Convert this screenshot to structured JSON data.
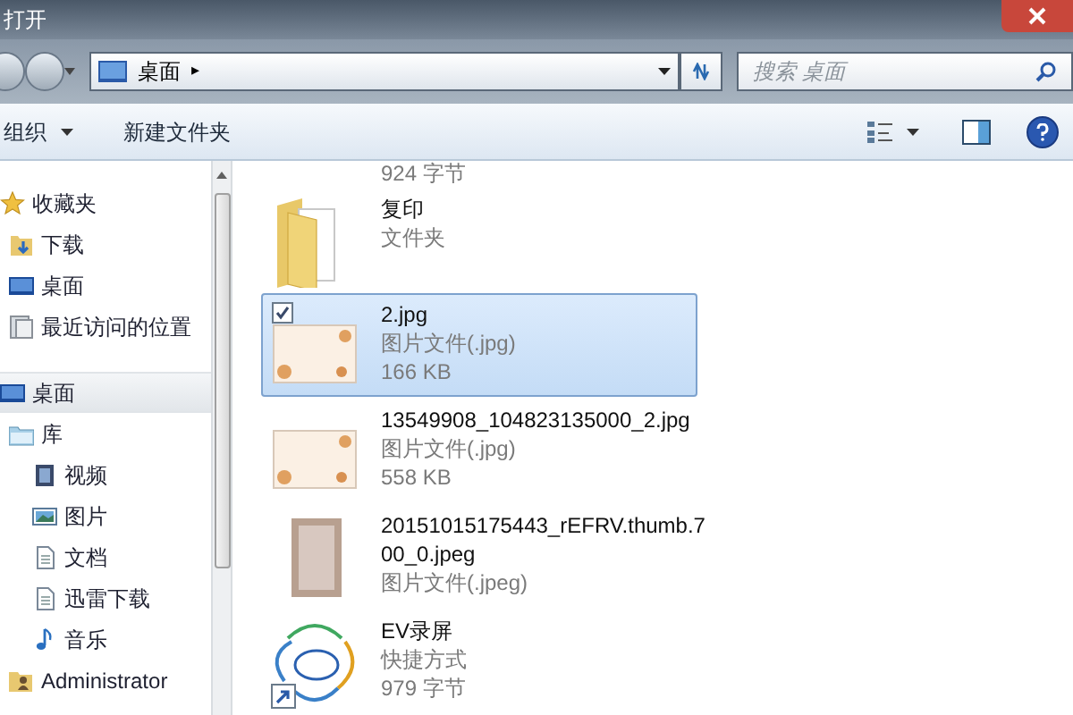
{
  "window": {
    "title": "打开"
  },
  "address": {
    "location": "桌面",
    "separator": "▸"
  },
  "search": {
    "placeholder": "搜索 桌面"
  },
  "toolbar": {
    "organize": "组织",
    "new_folder": "新建文件夹"
  },
  "sidebar": {
    "items": [
      {
        "label": "收藏夹",
        "kind": "star",
        "selected": false,
        "children": [
          {
            "label": "下载",
            "kind": "download",
            "selected": false
          },
          {
            "label": "桌面",
            "kind": "desktop",
            "selected": false
          },
          {
            "label": "最近访问的位置",
            "kind": "recent",
            "selected": false
          }
        ]
      },
      {
        "label": "桌面",
        "kind": "desktop",
        "selected": true,
        "children": [
          {
            "label": "库",
            "kind": "library",
            "selected": false,
            "children": [
              {
                "label": "视频",
                "kind": "video",
                "selected": false
              },
              {
                "label": "图片",
                "kind": "picture",
                "selected": false
              },
              {
                "label": "文档",
                "kind": "document",
                "selected": false
              },
              {
                "label": "迅雷下载",
                "kind": "document",
                "selected": false
              },
              {
                "label": "音乐",
                "kind": "music",
                "selected": false
              }
            ]
          },
          {
            "label": "Administrator",
            "kind": "user",
            "selected": false
          }
        ]
      }
    ]
  },
  "files": [
    {
      "kind": "partial",
      "lines": [
        "924 字节"
      ],
      "selected": false,
      "checked": false
    },
    {
      "kind": "folder",
      "lines": [
        "复印",
        "文件夹"
      ],
      "selected": false,
      "checked": false
    },
    {
      "kind": "image",
      "lines": [
        "2.jpg",
        "图片文件(.jpg)",
        "166 KB"
      ],
      "selected": true,
      "checked": true
    },
    {
      "kind": "image",
      "lines": [
        "13549908_104823135000_2.jpg",
        "图片文件(.jpg)",
        "558 KB"
      ],
      "selected": false,
      "checked": false
    },
    {
      "kind": "photo",
      "lines": [
        "20151015175443_rEFRV.thumb.7",
        "00_0.jpeg",
        "图片文件(.jpeg)"
      ],
      "selected": false,
      "checked": false
    },
    {
      "kind": "shortcut",
      "lines": [
        "EV录屏",
        "快捷方式",
        "979 字节"
      ],
      "selected": false,
      "checked": false
    }
  ]
}
